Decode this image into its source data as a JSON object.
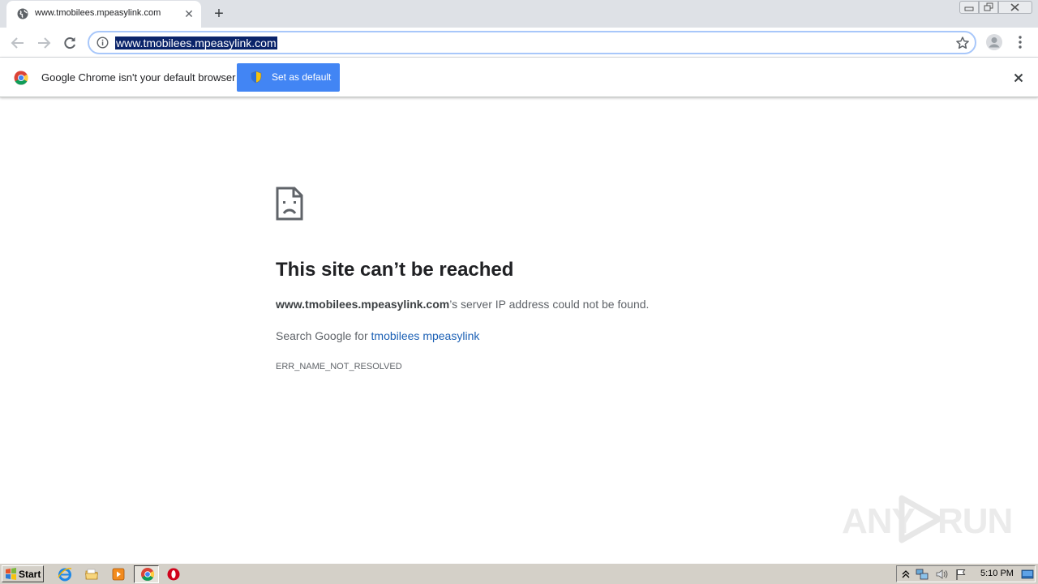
{
  "browser": {
    "tab": {
      "title": "www.tmobilees.mpeasylink.com",
      "favicon": "globe-icon"
    },
    "new_tab_symbol": "+",
    "window_controls": {
      "minimize": "▭",
      "maximize": "❐",
      "close": "✕"
    },
    "address_bar": {
      "url": "www.tmobilees.mpeasylink.com",
      "selected": true
    }
  },
  "infobar": {
    "message": "Google Chrome isn't your default browser",
    "button_label": "Set as default",
    "close_symbol": "✕"
  },
  "error_page": {
    "title": "This site can’t be reached",
    "host": "www.tmobilees.mpeasylink.com",
    "host_suffix": "’s server IP address could not be found.",
    "search_prefix": "Search Google for ",
    "search_query": "tmobilees mpeasylink",
    "error_code": "ERR_NAME_NOT_RESOLVED"
  },
  "watermark": {
    "left": "ANY",
    "right": "RUN"
  },
  "taskbar": {
    "start_label": "Start",
    "apps": [
      "internet-explorer-icon",
      "folder-icon",
      "media-player-icon",
      "chrome-icon",
      "opera-icon"
    ],
    "active_app": "chrome-icon",
    "clock": "5:10 PM"
  },
  "colors": {
    "accent": "#4285f4",
    "link": "#1a5fb4",
    "selection": "#0a246a",
    "tabstrip": "#dee1e6",
    "taskbar": "#d4d0c8"
  }
}
